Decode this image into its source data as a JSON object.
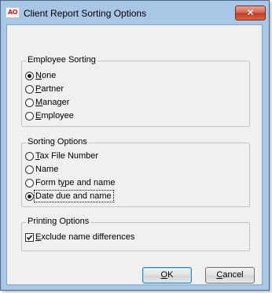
{
  "window": {
    "icon_text": "AO",
    "title": "Client Report Sorting Options",
    "close_glyph": "✕"
  },
  "employee_sorting": {
    "legend": "Employee Sorting",
    "options": [
      {
        "label": "None",
        "accel": "N",
        "rest": "one",
        "checked": true
      },
      {
        "label": "Partner",
        "accel": "P",
        "rest": "artner",
        "checked": false
      },
      {
        "label": "Manager",
        "accel": "M",
        "rest": "anager",
        "checked": false
      },
      {
        "label": "Employee",
        "accel": "E",
        "rest": "mployee",
        "checked": false
      }
    ]
  },
  "sorting_options": {
    "legend": "Sorting Options",
    "options": [
      {
        "label": "Tax File Number",
        "accel": "T",
        "rest": "ax File Number",
        "checked": false
      },
      {
        "label": "Name",
        "accel": "",
        "rest": "Name",
        "checked": false
      },
      {
        "label": "Form type and name",
        "pre": "Form t",
        "accel": "y",
        "rest": "pe and name",
        "checked": false
      },
      {
        "label": "Date due and name",
        "accel": "",
        "rest": "Date due and name",
        "checked": true
      }
    ]
  },
  "printing_options": {
    "legend": "Printing Options",
    "exclude": {
      "label": "Exclude name differences",
      "accel": "E",
      "rest": "xclude name differences",
      "checked": true
    }
  },
  "buttons": {
    "ok": {
      "accel": "O",
      "rest": "K"
    },
    "cancel": {
      "accel": "C",
      "rest": "ancel"
    }
  },
  "colors": {
    "title_bar": "#a9c6e6",
    "close_button": "#c13a24",
    "client_area": "#f0f0f0"
  }
}
